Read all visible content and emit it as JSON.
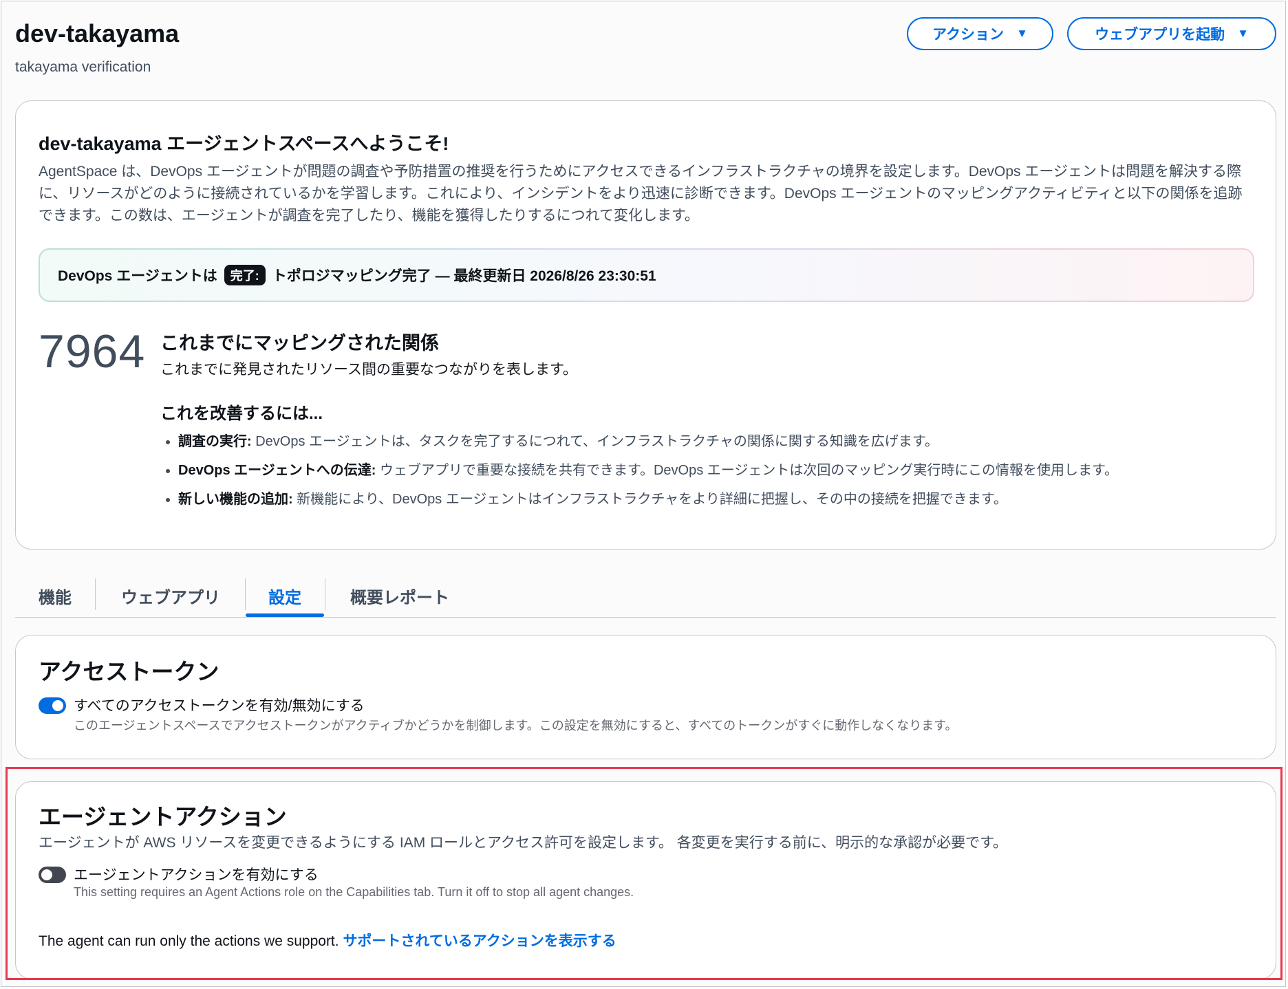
{
  "header": {
    "title": "dev-takayama",
    "subtitle": "takayama verification",
    "actions_button": "アクション",
    "launch_button": "ウェブアプリを起動"
  },
  "welcome": {
    "title": "dev-takayama エージェントスペースへようこそ!",
    "description": "AgentSpace は、DevOps エージェントが問題の調査や予防措置の推奨を行うためにアクセスできるインフラストラクチャの境界を設定します。DevOps エージェントは問題を解決する際に、リソースがどのように接続されているかを学習します。これにより、インシデントをより迅速に診断できます。DevOps エージェントのマッピングアクティビティと以下の関係を追跡できます。この数は、エージェントが調査を完了したり、機能を獲得したりするにつれて変化します。",
    "status_prefix": "DevOps エージェントは",
    "status_badge": "完了:",
    "status_text": "トポロジマッピング完了 — 最終更新日 2026/8/26 23:30:51",
    "relationship_count": "7964",
    "relationship_title": "これまでにマッピングされた関係",
    "relationship_desc": "これまでに発見されたリソース間の重要なつながりを表します。",
    "improve_title": "これを改善するには...",
    "improve_items": [
      {
        "bold": "調査の実行:",
        "text": " DevOps エージェントは、タスクを完了するにつれて、インフラストラクチャの関係に関する知識を広げます。"
      },
      {
        "bold": "DevOps エージェントへの伝達:",
        "text": " ウェブアプリで重要な接続を共有できます。DevOps エージェントは次回のマッピング実行時にこの情報を使用します。"
      },
      {
        "bold": "新しい機能の追加:",
        "text": " 新機能により、DevOps エージェントはインフラストラクチャをより詳細に把握し、その中の接続を把握できます。"
      }
    ]
  },
  "tabs": [
    {
      "label": "機能"
    },
    {
      "label": "ウェブアプリ"
    },
    {
      "label": "設定",
      "active": true
    },
    {
      "label": "概要レポート"
    }
  ],
  "access_tokens": {
    "title": "アクセストークン",
    "toggle_on": true,
    "toggle_label": "すべてのアクセストークンを有効/無効にする",
    "toggle_desc": "このエージェントスペースでアクセストークンがアクティブかどうかを制御します。この設定を無効にすると、すべてのトークンがすぐに動作しなくなります。"
  },
  "agent_actions": {
    "title": "エージェントアクション",
    "description": "エージェントが AWS リソースを変更できるようにする IAM ロールとアクセス許可を設定します。 各変更を実行する前に、明示的な承認が必要です。",
    "toggle_on": false,
    "toggle_label": "エージェントアクションを有効にする",
    "toggle_desc": "This setting requires an Agent Actions role on the Capabilities tab. Turn it off to stop all agent changes.",
    "footer_text": "The agent can run only the actions we support. ",
    "footer_link": "サポートされているアクションを表示する"
  },
  "colors": {
    "accent": "#006ce0",
    "highlight": "#e8384f"
  }
}
